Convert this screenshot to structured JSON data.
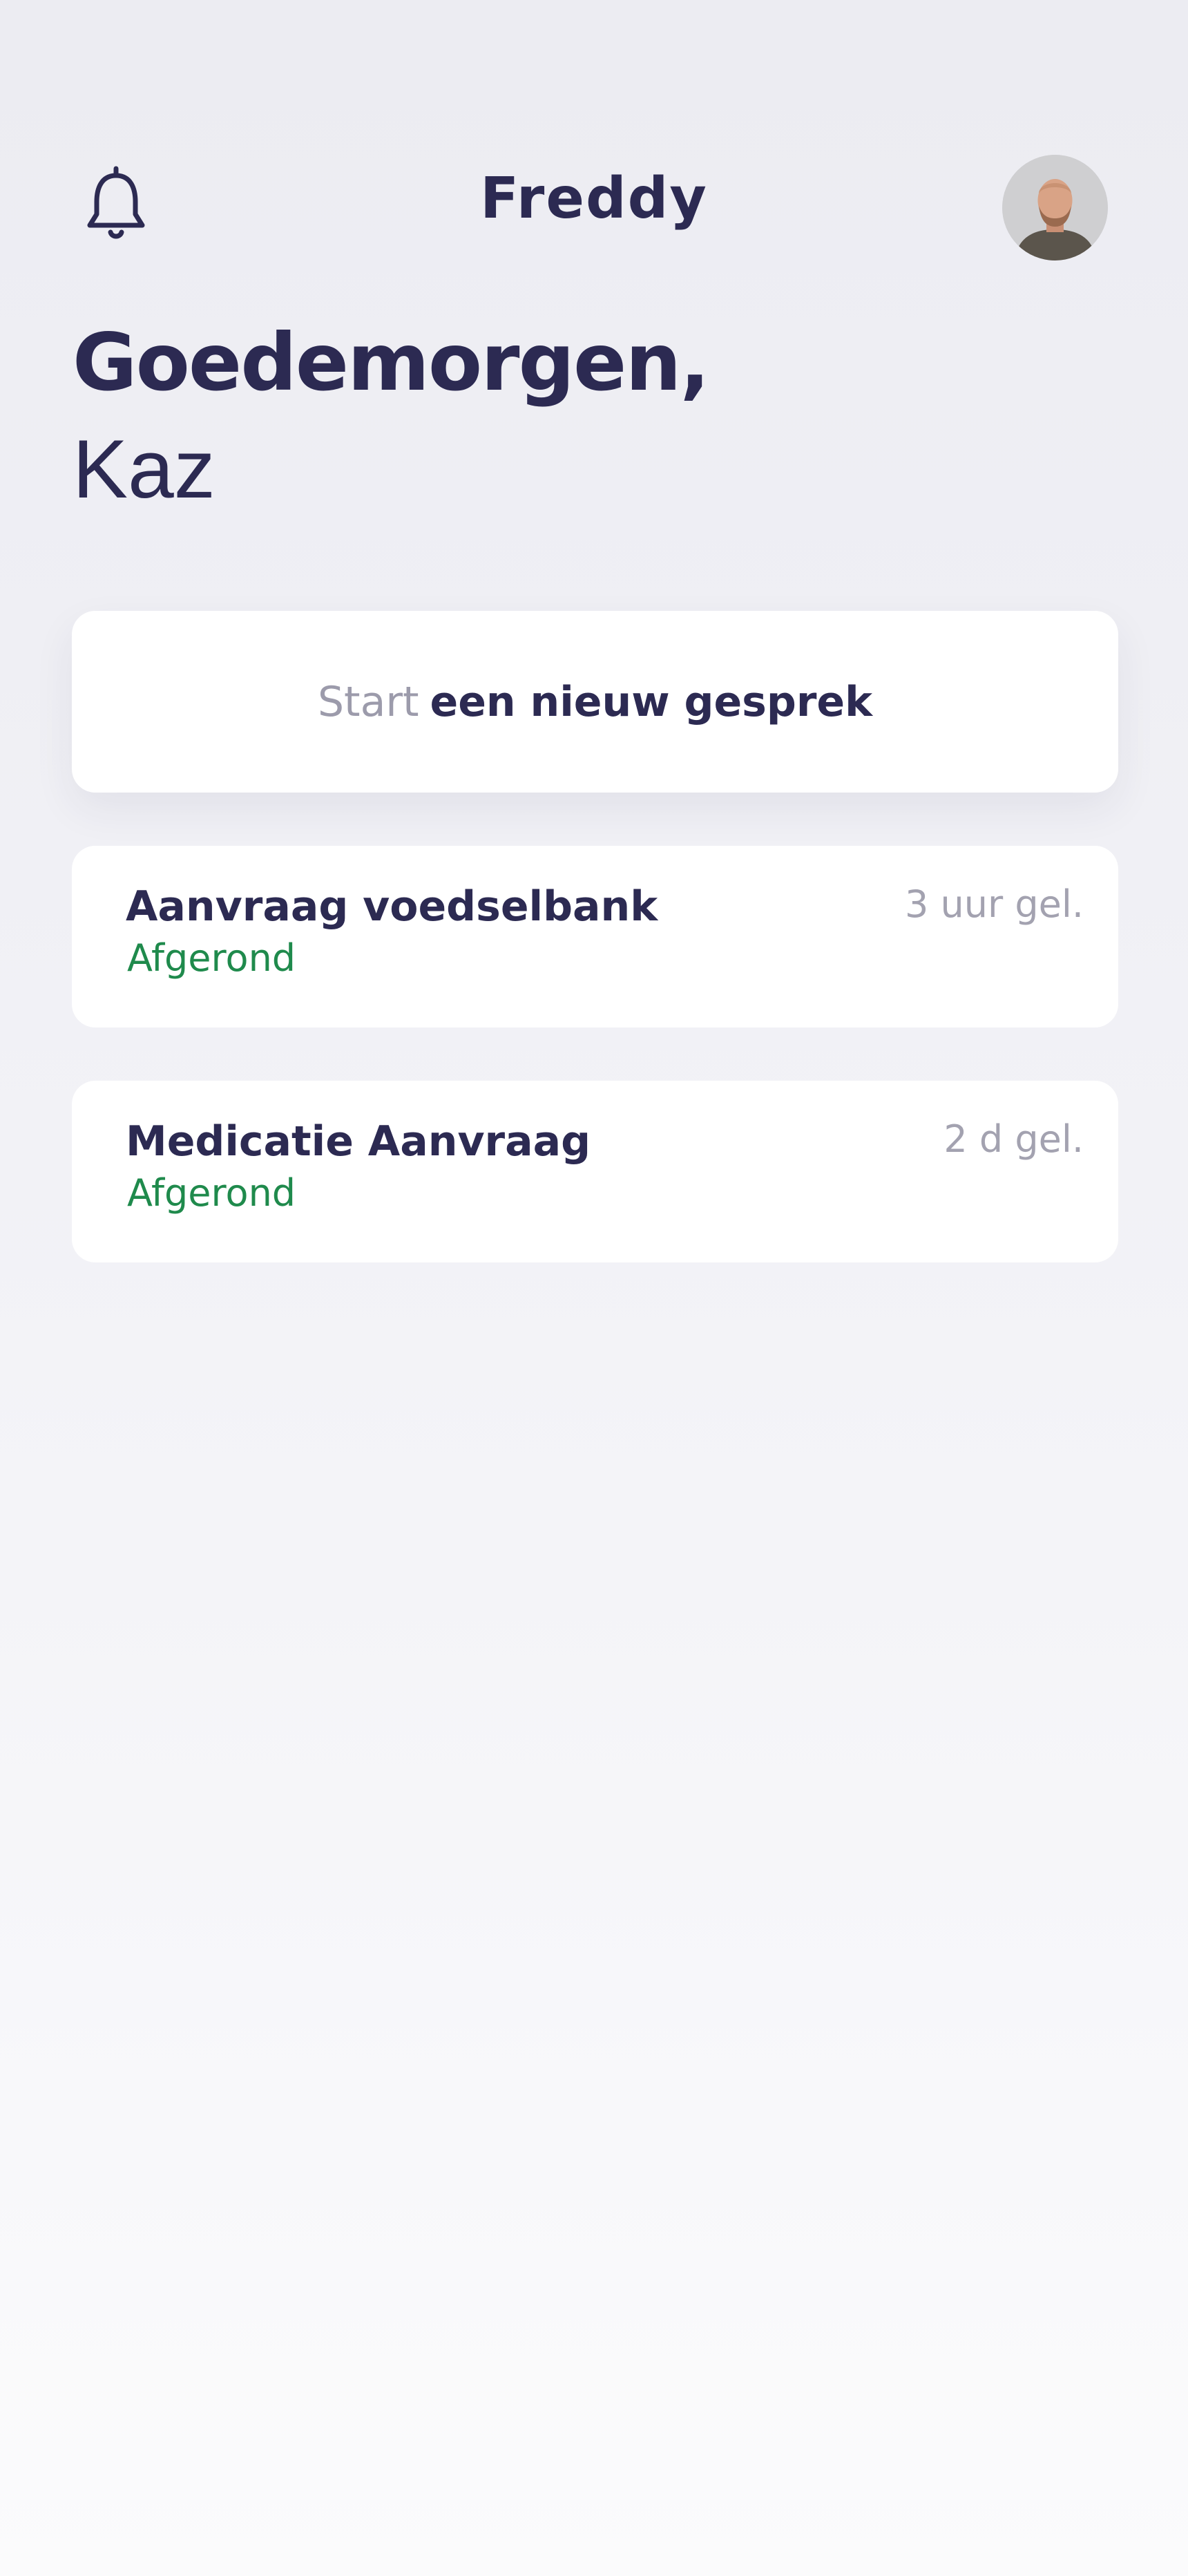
{
  "app": {
    "name": "Freddy"
  },
  "greeting": {
    "line1": "Goedemorgen,",
    "name": "Kaz"
  },
  "new_conversation": {
    "prefix": "Start",
    "label": "een nieuw gesprek"
  },
  "conversations": [
    {
      "title": "Aanvraag voedselbank",
      "status": "Afgerond",
      "time": "3 uur gel."
    },
    {
      "title": "Medicatie Aanvraag",
      "status": "Afgerond",
      "time": "2 d gel."
    }
  ],
  "icons": {
    "notifications": "bell-icon",
    "profile": "user-avatar"
  },
  "colors": {
    "primary": "#2c2a52",
    "muted": "#9c9bab",
    "success": "#1f8a4c",
    "card": "#ffffff"
  }
}
